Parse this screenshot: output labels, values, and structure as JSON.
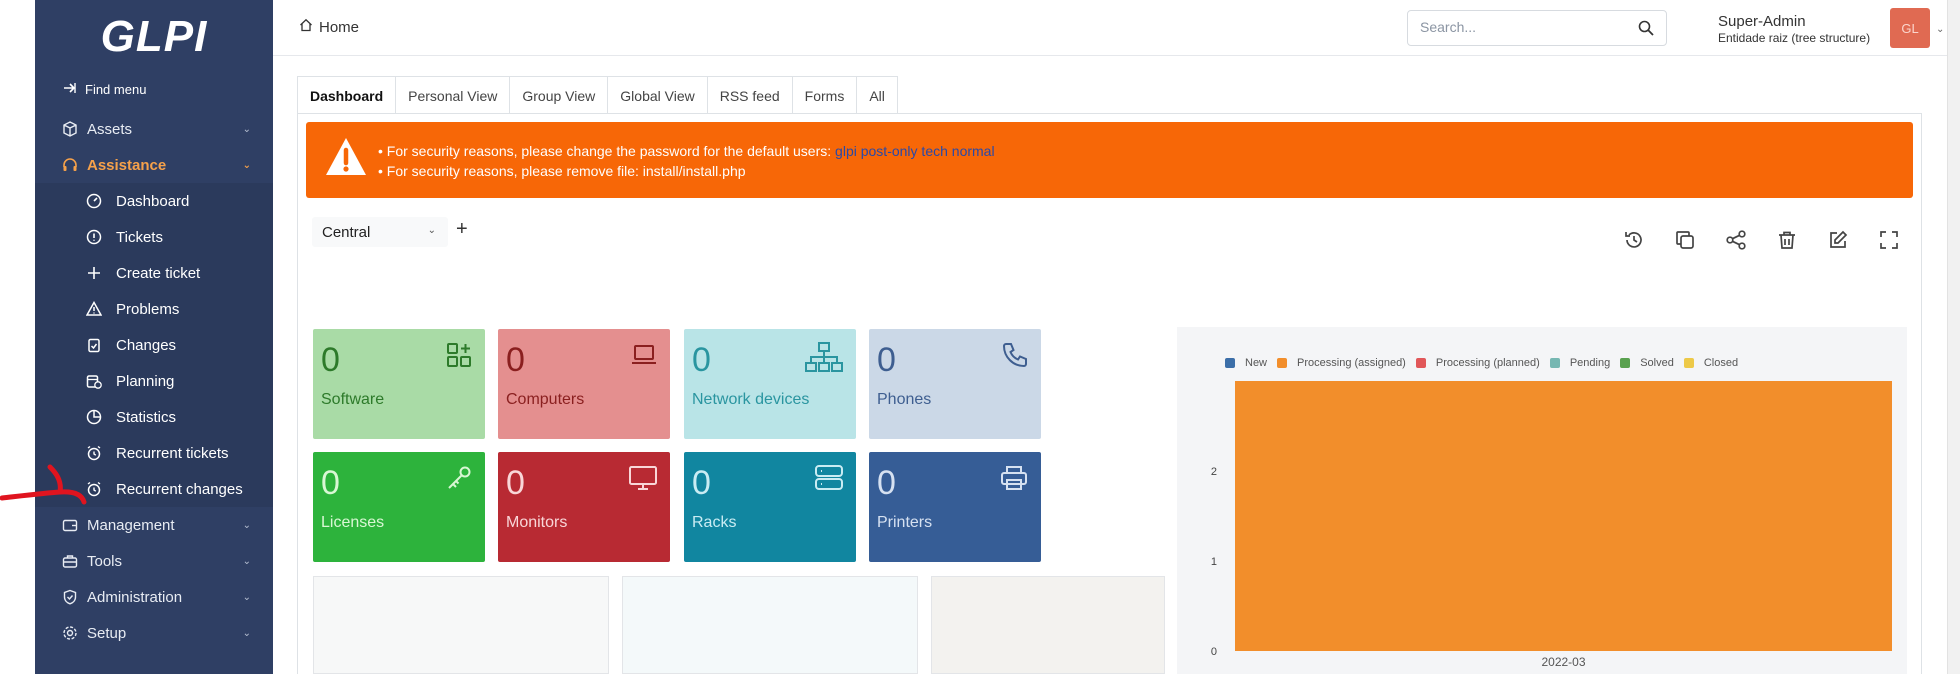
{
  "app": {
    "logo": "GLPI"
  },
  "sidebar": {
    "find_menu": "Find menu",
    "items": [
      {
        "label": "Assets",
        "icon": "cube-icon"
      },
      {
        "label": "Assistance",
        "icon": "headset-icon",
        "active": true
      },
      {
        "label": "Management",
        "icon": "wallet-icon"
      },
      {
        "label": "Tools",
        "icon": "briefcase-icon"
      },
      {
        "label": "Administration",
        "icon": "shield-icon"
      },
      {
        "label": "Setup",
        "icon": "gear-icon"
      }
    ],
    "sub_items": [
      {
        "label": "Dashboard",
        "icon": "dashboard-icon"
      },
      {
        "label": "Tickets",
        "icon": "alert-circle-icon"
      },
      {
        "label": "Create ticket",
        "icon": "plus-icon"
      },
      {
        "label": "Problems",
        "icon": "warning-triangle-icon"
      },
      {
        "label": "Changes",
        "icon": "clipboard-check-icon"
      },
      {
        "label": "Planning",
        "icon": "calendar-clock-icon"
      },
      {
        "label": "Statistics",
        "icon": "pie-chart-icon"
      },
      {
        "label": "Recurrent tickets",
        "icon": "alarm-clock-icon"
      },
      {
        "label": "Recurrent changes",
        "icon": "alarm-clock-icon"
      }
    ]
  },
  "header": {
    "breadcrumb": "Home",
    "search_placeholder": "Search...",
    "user_name": "Super-Admin",
    "user_entity": "Entidade raiz (tree structure)",
    "avatar_initials": "GL"
  },
  "tabs": [
    "Dashboard",
    "Personal View",
    "Group View",
    "Global View",
    "RSS feed",
    "Forms",
    "All"
  ],
  "alert": {
    "line1_prefix": "For security reasons, please change the password for the default users: ",
    "line1_links": "glpi post-only tech normal",
    "line2": "For security reasons, please remove file: install/install.php",
    "color": "#f76707"
  },
  "dashboard": {
    "selector_value": "Central",
    "add_label": "+"
  },
  "cards": [
    {
      "value": "0",
      "label": "Software",
      "bg": "#a9dba6",
      "fg": "#2d7a2a",
      "icon": "apps-add-icon"
    },
    {
      "value": "0",
      "label": "Computers",
      "bg": "#e48f8f",
      "fg": "#8a1f1f",
      "icon": "laptop-icon"
    },
    {
      "value": "0",
      "label": "Network devices",
      "bg": "#b9e4e7",
      "fg": "#2a95a0",
      "icon": "network-icon"
    },
    {
      "value": "0",
      "label": "Phones",
      "bg": "#cbd8e7",
      "fg": "#3e5e90",
      "icon": "phone-icon"
    },
    {
      "value": "0",
      "label": "Licenses",
      "bg": "#2db33c",
      "fg": "#d9f7d4",
      "icon": "key-icon"
    },
    {
      "value": "0",
      "label": "Monitors",
      "bg": "#b82a33",
      "fg": "#f9d6d8",
      "icon": "monitor-icon"
    },
    {
      "value": "0",
      "label": "Racks",
      "bg": "#1186a0",
      "fg": "#c9ecf3",
      "icon": "server-icon"
    },
    {
      "value": "0",
      "label": "Printers",
      "bg": "#365d96",
      "fg": "#d6e1f1",
      "icon": "printer-icon"
    }
  ],
  "chart_data": {
    "type": "bar",
    "categories": [
      "2022-03"
    ],
    "series": [
      {
        "name": "New",
        "color": "#3b6ea8",
        "values": [
          0
        ]
      },
      {
        "name": "Processing (assigned)",
        "color": "#f28e2b",
        "values": [
          3
        ]
      },
      {
        "name": "Processing (planned)",
        "color": "#e15759",
        "values": [
          0
        ]
      },
      {
        "name": "Pending",
        "color": "#76b7b2",
        "values": [
          0
        ]
      },
      {
        "name": "Solved",
        "color": "#59a14f",
        "values": [
          0
        ]
      },
      {
        "name": "Closed",
        "color": "#edc948",
        "values": [
          0
        ]
      }
    ],
    "y_ticks": [
      0,
      1,
      2
    ],
    "ylim": [
      0,
      3
    ],
    "legend": "top-left",
    "grid": false
  }
}
